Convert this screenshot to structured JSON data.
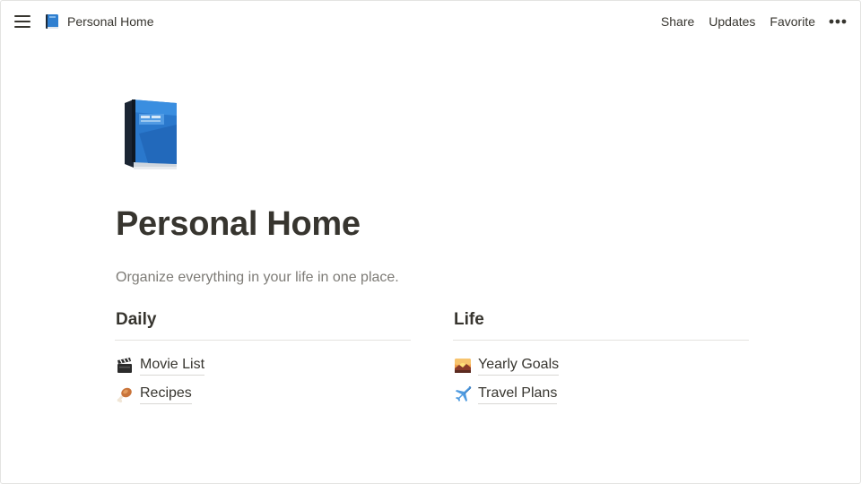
{
  "header": {
    "page_title": "Personal Home",
    "page_icon": "blue-book-icon",
    "actions": {
      "share": "Share",
      "updates": "Updates",
      "favorite": "Favorite"
    },
    "menu_icon": "hamburger-menu-icon",
    "more_icon": "more-dots-icon"
  },
  "page": {
    "icon": "blue-book-icon",
    "title": "Personal Home",
    "description": "Organize everything in your life in one place."
  },
  "columns": [
    {
      "heading": "Daily",
      "links": [
        {
          "icon": "clapper-board-icon",
          "label": "Movie List"
        },
        {
          "icon": "poultry-leg-icon",
          "label": "Recipes"
        }
      ]
    },
    {
      "heading": "Life",
      "links": [
        {
          "icon": "sunrise-icon",
          "label": "Yearly Goals"
        },
        {
          "icon": "airplane-icon",
          "label": "Travel Plans"
        }
      ]
    }
  ],
  "colors": {
    "text": "#37352f",
    "muted_text": "#7d7b76",
    "divider": "#e4e3df",
    "book_blue": "#2f7fd0"
  }
}
